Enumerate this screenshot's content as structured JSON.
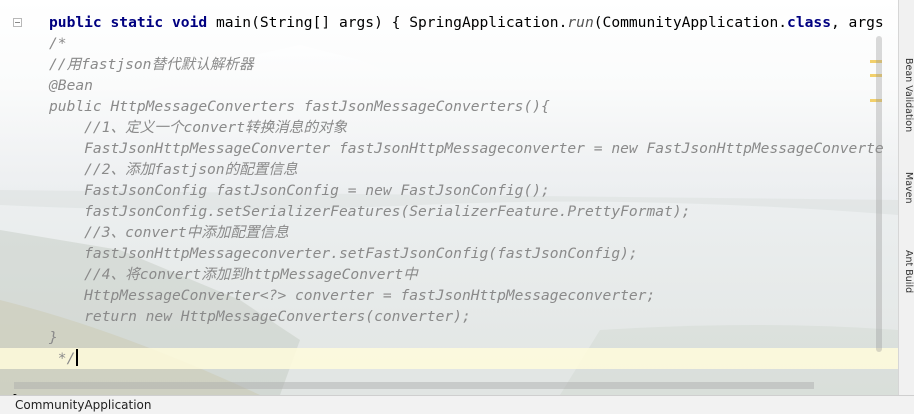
{
  "editor": {
    "lines": [
      {
        "parts": [
          {
            "t": "public static void ",
            "c": "kw"
          },
          {
            "t": "main(String[] args) { SpringApplication."
          },
          {
            "t": "run",
            "c": "it"
          },
          {
            "t": "(CommunityApplication."
          },
          {
            "t": "class",
            "c": "kw"
          },
          {
            "t": ", args"
          }
        ],
        "fold": true
      },
      {
        "parts": [
          {
            "t": "/*",
            "c": "cm"
          }
        ]
      },
      {
        "parts": [
          {
            "t": "//用fastjson替代默认解析器",
            "c": "cm"
          }
        ]
      },
      {
        "parts": [
          {
            "t": "@Bean",
            "c": "cm"
          }
        ]
      },
      {
        "parts": [
          {
            "t": "public HttpMessageConverters fastJsonMessageConverters(){",
            "c": "cm"
          }
        ]
      },
      {
        "parts": [
          {
            "t": "    //1、定义一个convert转换消息的对象",
            "c": "cm"
          }
        ]
      },
      {
        "parts": [
          {
            "t": "    FastJsonHttpMessageConverter fastJsonHttpMessageconverter = new FastJsonHttpMessageConverte",
            "c": "cm"
          }
        ]
      },
      {
        "parts": [
          {
            "t": "    //2、添加fastjson的配置信息",
            "c": "cm"
          }
        ]
      },
      {
        "parts": [
          {
            "t": "    FastJsonConfig fastJsonConfig = new FastJsonConfig();",
            "c": "cm"
          }
        ]
      },
      {
        "parts": [
          {
            "t": "    fastJsonConfig.setSerializerFeatures(SerializerFeature.PrettyFormat);",
            "c": "cm"
          }
        ]
      },
      {
        "parts": [
          {
            "t": "    //3、convert中添加配置信息",
            "c": "cm"
          }
        ]
      },
      {
        "parts": [
          {
            "t": "    fastJsonHttpMessageconverter.setFastJsonConfig(fastJsonConfig);",
            "c": "cm"
          }
        ]
      },
      {
        "parts": [
          {
            "t": "    //4、将convert添加到httpMessageConvert中",
            "c": "cm"
          }
        ]
      },
      {
        "parts": [
          {
            "t": "    HttpMessageConverter<?> converter = fastJsonHttpMessageconverter;",
            "c": "cm"
          }
        ]
      },
      {
        "parts": [
          {
            "t": "    return new HttpMessageConverters(converter);",
            "c": "cm"
          }
        ]
      },
      {
        "parts": [
          {
            "t": "}",
            "c": "cm"
          }
        ]
      },
      {
        "parts": [
          {
            "t": " */",
            "c": "cm"
          }
        ],
        "current": true
      },
      {
        "parts": []
      },
      {
        "parts": [
          {
            "t": "}"
          }
        ],
        "outdent": true
      }
    ]
  },
  "side_tabs": [
    "Bean Validation",
    "Maven",
    "Ant Build"
  ],
  "status_bar": {
    "breadcrumb": "CommunityApplication"
  }
}
